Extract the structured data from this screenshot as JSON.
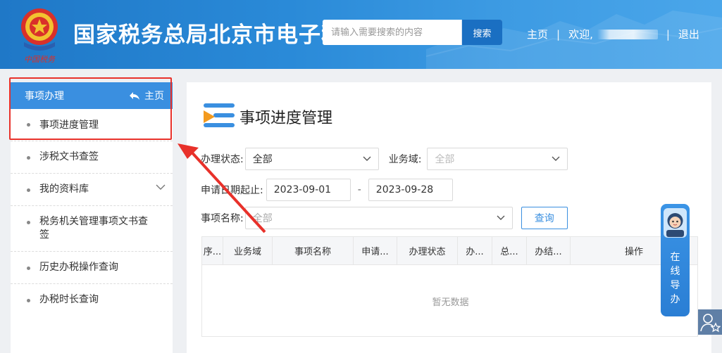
{
  "header": {
    "title": "国家税务总局北京市电子税",
    "search_placeholder": "请输入需要搜索的内容",
    "search_button": "搜索",
    "nav_home": "主页",
    "separator": "|",
    "welcome": "欢迎,",
    "logout": "退出",
    "colors": {
      "primary": "#1f78c7",
      "accent": "#1a6fc2"
    }
  },
  "sidebar": {
    "header_label": "事项办理",
    "home_link": "主页",
    "items": [
      {
        "label": "事项进度管理"
      },
      {
        "label": "涉税文书查签"
      },
      {
        "label": "我的资料库"
      },
      {
        "label": "税务机关管理事项文书查签"
      },
      {
        "label": "历史办税操作查询"
      },
      {
        "label": "办税时长查询"
      }
    ]
  },
  "main": {
    "page_title": "事项进度管理",
    "filters": {
      "status_label": "办理状态:",
      "status_value": "全部",
      "domain_label": "业务域:",
      "domain_value": "全部",
      "date_label": "申请日期起止:",
      "date_start": "2023-09-01",
      "date_sep": "-",
      "date_end": "2023-09-28",
      "item_name_label": "事项名称:",
      "item_name_value": "全部",
      "query_button": "查询"
    },
    "table": {
      "headers": [
        "序...",
        "业务域",
        "事项名称",
        "申请...",
        "办理状态",
        "办...",
        "总...",
        "办结...",
        "操作"
      ],
      "empty_text": "暂无数据"
    }
  },
  "assistant": {
    "text": [
      "在",
      "线",
      "导",
      "办"
    ]
  }
}
